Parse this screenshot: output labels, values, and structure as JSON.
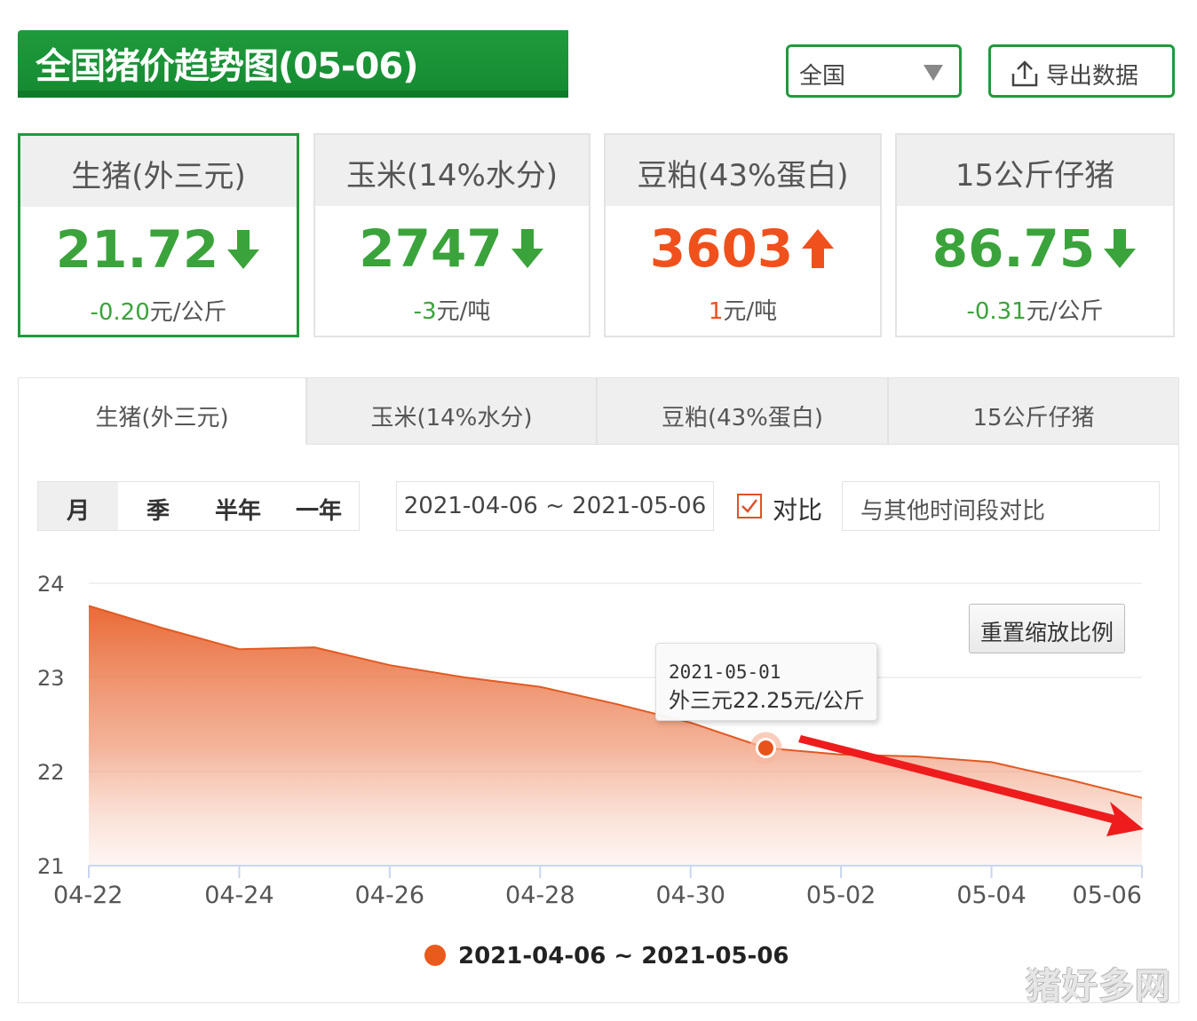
{
  "header": {
    "title": "全国猪价趋势图(05-06)",
    "region_select": "全国",
    "export_label": "导出数据"
  },
  "cards": [
    {
      "name": "生猪(外三元)",
      "value": "21.72",
      "change": "-0.20",
      "unit": "元/公斤",
      "trend": "down"
    },
    {
      "name": "玉米(14%水分)",
      "value": "2747",
      "change": "-3",
      "unit": "元/吨",
      "trend": "down"
    },
    {
      "name": "豆粕(43%蛋白)",
      "value": "3603",
      "change": "1",
      "unit": "元/吨",
      "trend": "up"
    },
    {
      "name": "15公斤仔猪",
      "value": "86.75",
      "change": "-0.31",
      "unit": "元/公斤",
      "trend": "down"
    }
  ],
  "tabs": [
    "生猪(外三元)",
    "玉米(14%水分)",
    "豆粕(43%蛋白)",
    "15公斤仔猪"
  ],
  "controls": {
    "periods": [
      "月",
      "季",
      "半年",
      "一年"
    ],
    "date_range": "2021-04-06 ~ 2021-05-06",
    "compare_label": "对比",
    "compare_placeholder": "与其他时间段对比",
    "reset_label": "重置缩放比例"
  },
  "tooltip": {
    "date": "2021-05-01",
    "text": "外三元22.25元/公斤"
  },
  "colors": {
    "brand_green": "#1f9a3c",
    "down_green": "#3ba33b",
    "up_red": "#f0511c",
    "series": "#ea5a1c"
  },
  "chart_data": {
    "type": "area",
    "x": [
      "04-22",
      "04-23",
      "04-24",
      "04-25",
      "04-26",
      "04-27",
      "04-28",
      "04-29",
      "04-30",
      "05-01",
      "05-02",
      "05-03",
      "05-04",
      "05-05",
      "05-06"
    ],
    "series": [
      {
        "name": "2021-04-06 ~ 2021-05-06",
        "values": [
          23.76,
          23.52,
          23.3,
          23.32,
          23.13,
          23.0,
          22.9,
          22.72,
          22.52,
          22.25,
          22.18,
          22.16,
          22.1,
          21.92,
          21.72
        ]
      }
    ],
    "xticks": [
      "04-22",
      "04-24",
      "04-26",
      "04-28",
      "04-30",
      "05-02",
      "05-04",
      "05-06"
    ],
    "yticks": [
      21,
      22,
      23,
      24
    ],
    "ylim": [
      21,
      24
    ],
    "highlight_x": "05-01",
    "grid": true,
    "legend": "bottom-center"
  },
  "watermark": "猪好多网"
}
